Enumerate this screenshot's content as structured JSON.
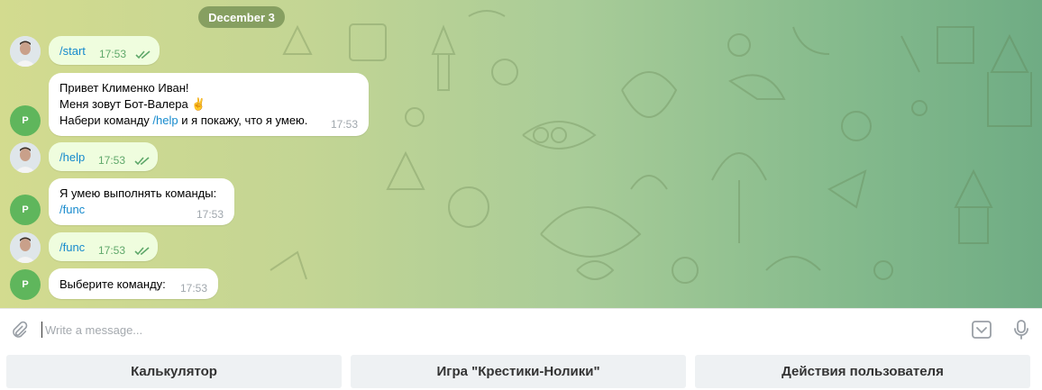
{
  "chat": {
    "date_label": "December 3",
    "bot_avatar_initial": "P",
    "messages": [
      {
        "direction": "out",
        "lines": [
          "/start"
        ],
        "time": "17:53",
        "status": "read"
      },
      {
        "direction": "in",
        "lines": [
          "Привет Клименко Иван!",
          "Меня зовут Бот-Валера ✌️",
          "Набери команду",
          "/help",
          "и я покажу, что я умею."
        ],
        "time": "17:53"
      },
      {
        "direction": "out",
        "lines": [
          "/help"
        ],
        "time": "17:53",
        "status": "read"
      },
      {
        "direction": "in",
        "lines": [
          "Я умею выполнять команды:",
          "/func"
        ],
        "time": "17:53"
      },
      {
        "direction": "out",
        "lines": [
          "/func"
        ],
        "time": "17:53",
        "status": "read"
      },
      {
        "direction": "in",
        "lines": [
          "Выберите команду:"
        ],
        "time": "17:53"
      }
    ]
  },
  "composer": {
    "placeholder": "Write a message...",
    "attach_icon": "paperclip-icon",
    "emoji_icon": "bot-keyboard-icon",
    "mic_icon": "microphone-icon"
  },
  "keyboard": {
    "buttons": [
      "Калькулятор",
      "Игра \"Крестики-Нолики\"",
      "Действия пользователя"
    ]
  },
  "colors": {
    "link": "#168acd",
    "outgoing_bubble": "#effdde",
    "read_check": "#5fa86a",
    "bot_avatar": "#5fb65c"
  }
}
